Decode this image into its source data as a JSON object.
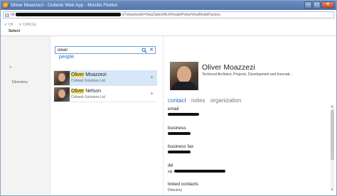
{
  "window": {
    "title": "Oliver Moazzezi - Outlook Web App - Mozilla Firefox",
    "min": "–",
    "max": "□",
    "close": "✕"
  },
  "url": {
    "prefix": "htt",
    "path": "s/?viewmodel=OwaOptionRichPeoplePickerViewModelFactory"
  },
  "toolbar": {
    "ok_label": "✔ OK",
    "cancel_label": "✕ CANCEL"
  },
  "dialog": {
    "select_label": "Select"
  },
  "leftpane": {
    "expand": "»",
    "directory_label": "Directory"
  },
  "search": {
    "value": "oliver",
    "people_label": "people"
  },
  "results": [
    {
      "highlight": "Oliver",
      "rest": " Moazzezi",
      "org": "Coliweb Solutions Ltd",
      "add": "+"
    },
    {
      "highlight": "Oliver",
      "rest": " Nelson",
      "org": "Coliweb Solutions Ltd",
      "add": "+"
    }
  ],
  "contact": {
    "name": "Oliver Moazzezi",
    "title": "Technical Architect, Projects, Development and Innovati...",
    "tabs": [
      "contact",
      "notes",
      "organization"
    ],
    "fields": {
      "email": "email",
      "business": "business",
      "business_fax": "business fax",
      "im": "IM",
      "im_prefix": "sip",
      "linked_contacts": "linked contacts",
      "directory": "Directory"
    }
  },
  "colors": {
    "accent": "#1f6fbf",
    "selected_row": "#d5e7f8",
    "highlight": "#f7e36a",
    "titlebar": "#5f82b8"
  }
}
